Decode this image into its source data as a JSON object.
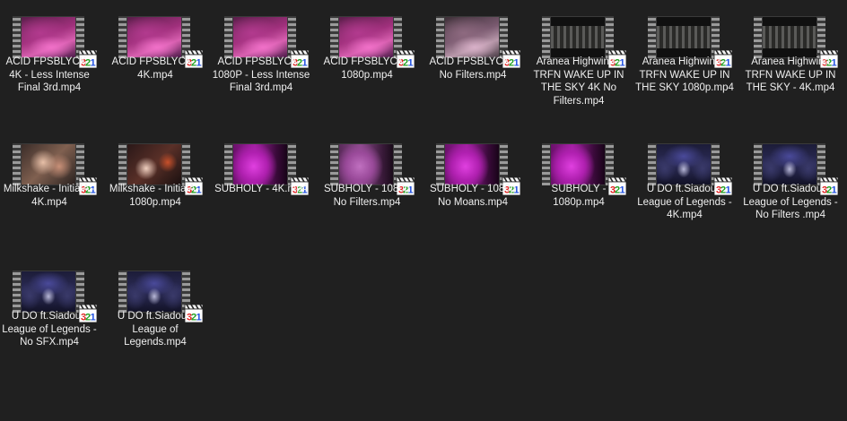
{
  "files": [
    {
      "name": "ACID FPSBLYCK - 4K - Less Intense Final 3rd.mp4",
      "thumb": "art-acid"
    },
    {
      "name": "ACID FPSBLYCK - 4K.mp4",
      "thumb": "art-acid"
    },
    {
      "name": "ACID FPSBLYCK - 1080P - Less Intense Final 3rd.mp4",
      "thumb": "art-acid"
    },
    {
      "name": "ACID FPSBLYCK - 1080p.mp4",
      "thumb": "art-acid"
    },
    {
      "name": "ACID FPSBLYCK - No Filters.mp4",
      "thumb": "art-acid-nf"
    },
    {
      "name": "Aranea Highwind - TRFN WAKE UP IN THE SKY 4K No Filters.mp4",
      "thumb": "art-aranea"
    },
    {
      "name": "Aranea Highwind - TRFN WAKE UP IN THE SKY 1080p.mp4",
      "thumb": "art-aranea"
    },
    {
      "name": "Aranea Highwind TRFN WAKE UP IN THE SKY - 4K.mp4",
      "thumb": "art-aranea"
    },
    {
      "name": "Milkshake - InitialA - 4K.mp4",
      "thumb": "art-milk"
    },
    {
      "name": "Milkshake - InitialA - 1080p.mp4",
      "thumb": "art-milk2"
    },
    {
      "name": "SUBHOLY - 4K.mp4",
      "thumb": "art-subholy"
    },
    {
      "name": "SUBHOLY - 1080p No Filters.mp4",
      "thumb": "art-subholy-nf"
    },
    {
      "name": "SUBHOLY - 1080p No Moans.mp4",
      "thumb": "art-subholy"
    },
    {
      "name": "SUBHOLY - 1080p.mp4",
      "thumb": "art-subholy"
    },
    {
      "name": "U DO ft.Siadou - League of Legends - 4K.mp4",
      "thumb": "art-udo"
    },
    {
      "name": "U DO ft.Siadou - League of Legends - No Filters .mp4",
      "thumb": "art-udo"
    },
    {
      "name": "U DO ft.Siadou - League of Legends - No SFX.mp4",
      "thumb": "art-udo"
    },
    {
      "name": "U DO ft.Siadou - League of Legends.mp4",
      "thumb": "art-udo"
    }
  ],
  "badge_text": "321",
  "icon": "mpc-hc-media-player-icon"
}
